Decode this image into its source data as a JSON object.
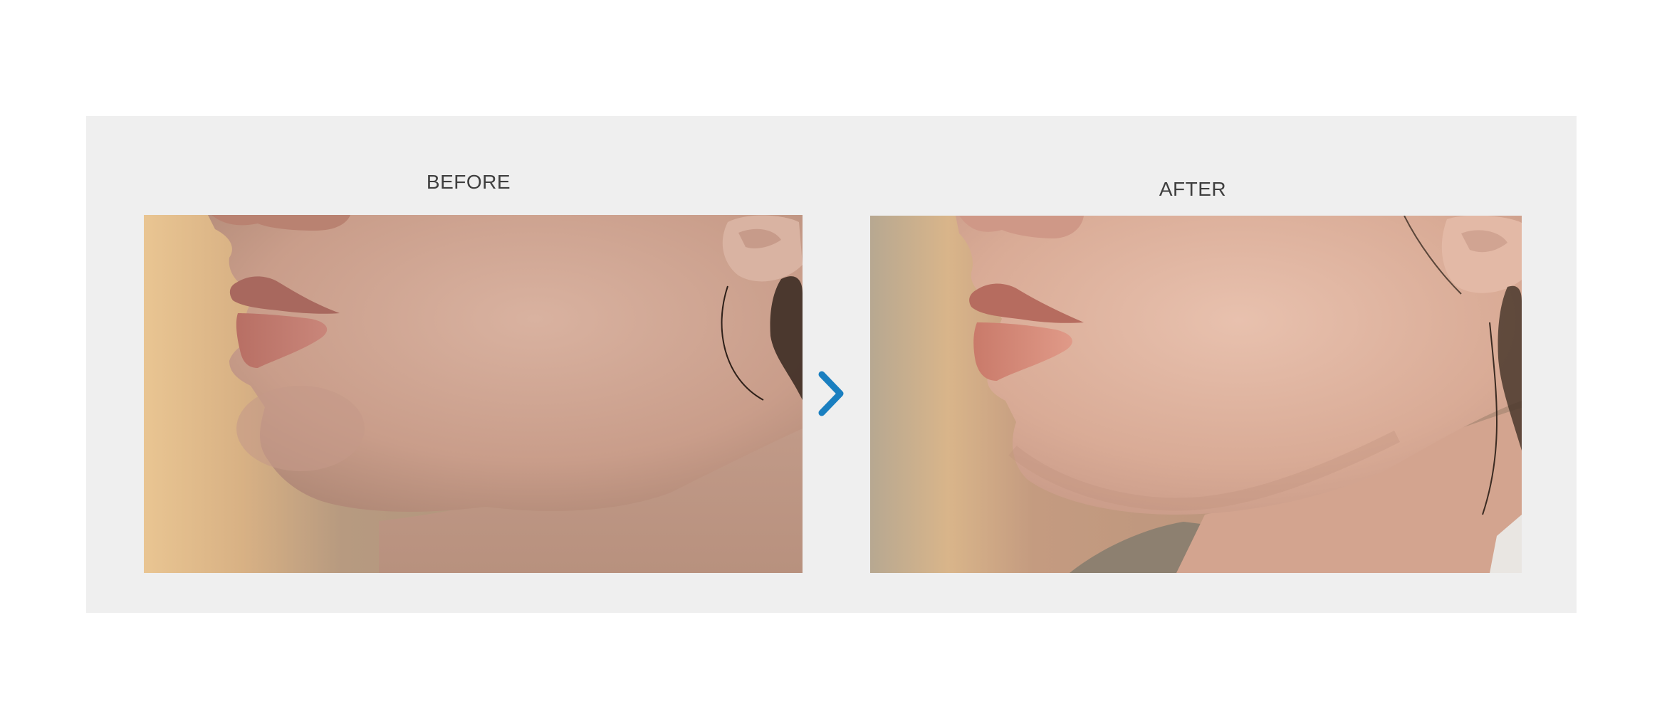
{
  "comparison": {
    "before_label": "BEFORE",
    "after_label": "AFTER"
  },
  "images": {
    "before": {
      "alt": "before-photo"
    },
    "after": {
      "alt": "after-photo"
    }
  },
  "icons": {
    "arrow": "chevron-right-icon"
  },
  "colors": {
    "panel_background": "#efefef",
    "label_text": "#3f3f3f",
    "arrow_accent": "#1a7fc0"
  }
}
